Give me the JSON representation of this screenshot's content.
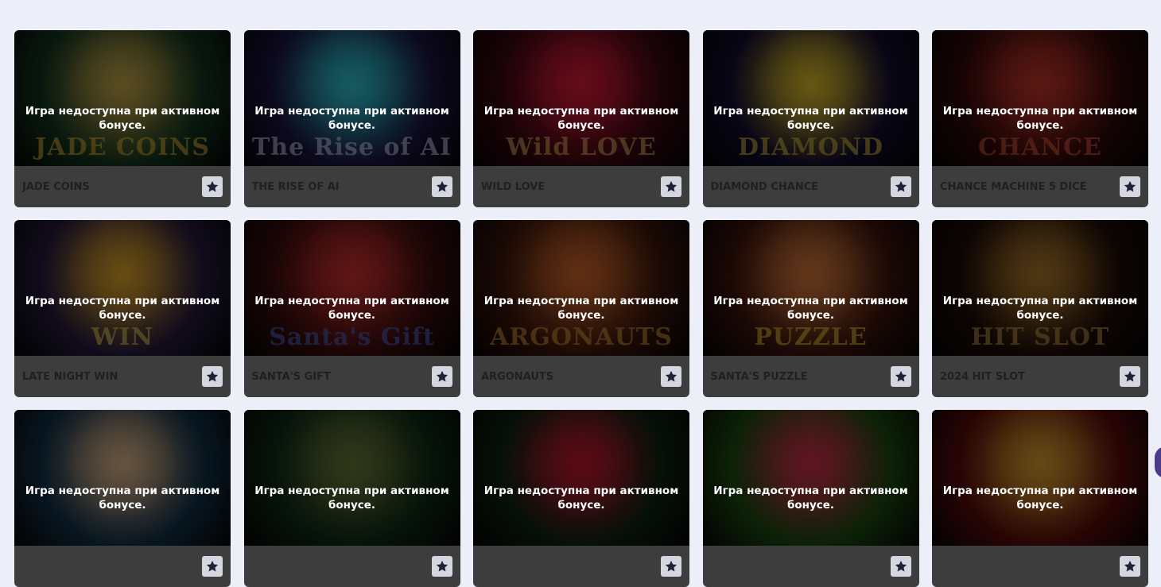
{
  "notice_text": "Игра недоступна при активном бонусе.",
  "games": [
    {
      "title": "JADE COINS",
      "logo": "JADE COINS",
      "bg": "#12361f",
      "glow": "#c8a84a",
      "logo_color": "#e2b13a"
    },
    {
      "title": "THE RISE OF AI",
      "logo": "The Rise of AI",
      "bg": "#1a1440",
      "glow": "#2fc9d6",
      "logo_color": "#d0d0f0"
    },
    {
      "title": "WILD LOVE",
      "logo": "Wild LOVE",
      "bg": "#3a0710",
      "glow": "#e01b3a",
      "logo_color": "#e5b060"
    },
    {
      "title": "DIAMOND CHANCE",
      "logo": "DIAMOND",
      "bg": "#120d30",
      "glow": "#e0c02a",
      "logo_color": "#ddc23a"
    },
    {
      "title": "CHANCE MACHINE 5 DICE",
      "logo": "CHANCE",
      "bg": "#300808",
      "glow": "#c8352a",
      "logo_color": "#e05a3a"
    },
    {
      "title": "LATE NIGHT WIN",
      "logo": "WIN",
      "bg": "#251a3e",
      "glow": "#e5a72a",
      "logo_color": "#e5d05a"
    },
    {
      "title": "SANTA'S GIFT",
      "logo": "Santa's Gift",
      "bg": "#3a0c0c",
      "glow": "#d23030",
      "logo_color": "#4a6ad0"
    },
    {
      "title": "ARGONAUTS",
      "logo": "ARGONAUTS",
      "bg": "#3a150a",
      "glow": "#d4682a",
      "logo_color": "#d69a3a"
    },
    {
      "title": "SANTA'S PUZZLE",
      "logo": "PUZZLE",
      "bg": "#3a120a",
      "glow": "#d87a3a",
      "logo_color": "#e5c23a"
    },
    {
      "title": "2024 HIT SLOT",
      "logo": "HIT SLOT",
      "bg": "#1e0c08",
      "glow": "#b07a2a",
      "logo_color": "#c49a4a"
    },
    {
      "title": "",
      "logo": "",
      "bg": "#12324a",
      "glow": "#e2b88a",
      "logo_color": "#e5c07a"
    },
    {
      "title": "",
      "logo": "",
      "bg": "#0d2a14",
      "glow": "#6a7a3a",
      "logo_color": "#a0a05a"
    },
    {
      "title": "",
      "logo": "",
      "bg": "#0c2410",
      "glow": "#c81830",
      "logo_color": "#e04050"
    },
    {
      "title": "",
      "logo": "",
      "bg": "#1a4a10",
      "glow": "#d0304a",
      "logo_color": "#e0506a"
    },
    {
      "title": "",
      "logo": "",
      "bg": "#5a0a0a",
      "glow": "#e0a030",
      "logo_color": "#e5c04a"
    }
  ],
  "icons": {
    "favorite": "star-icon"
  }
}
